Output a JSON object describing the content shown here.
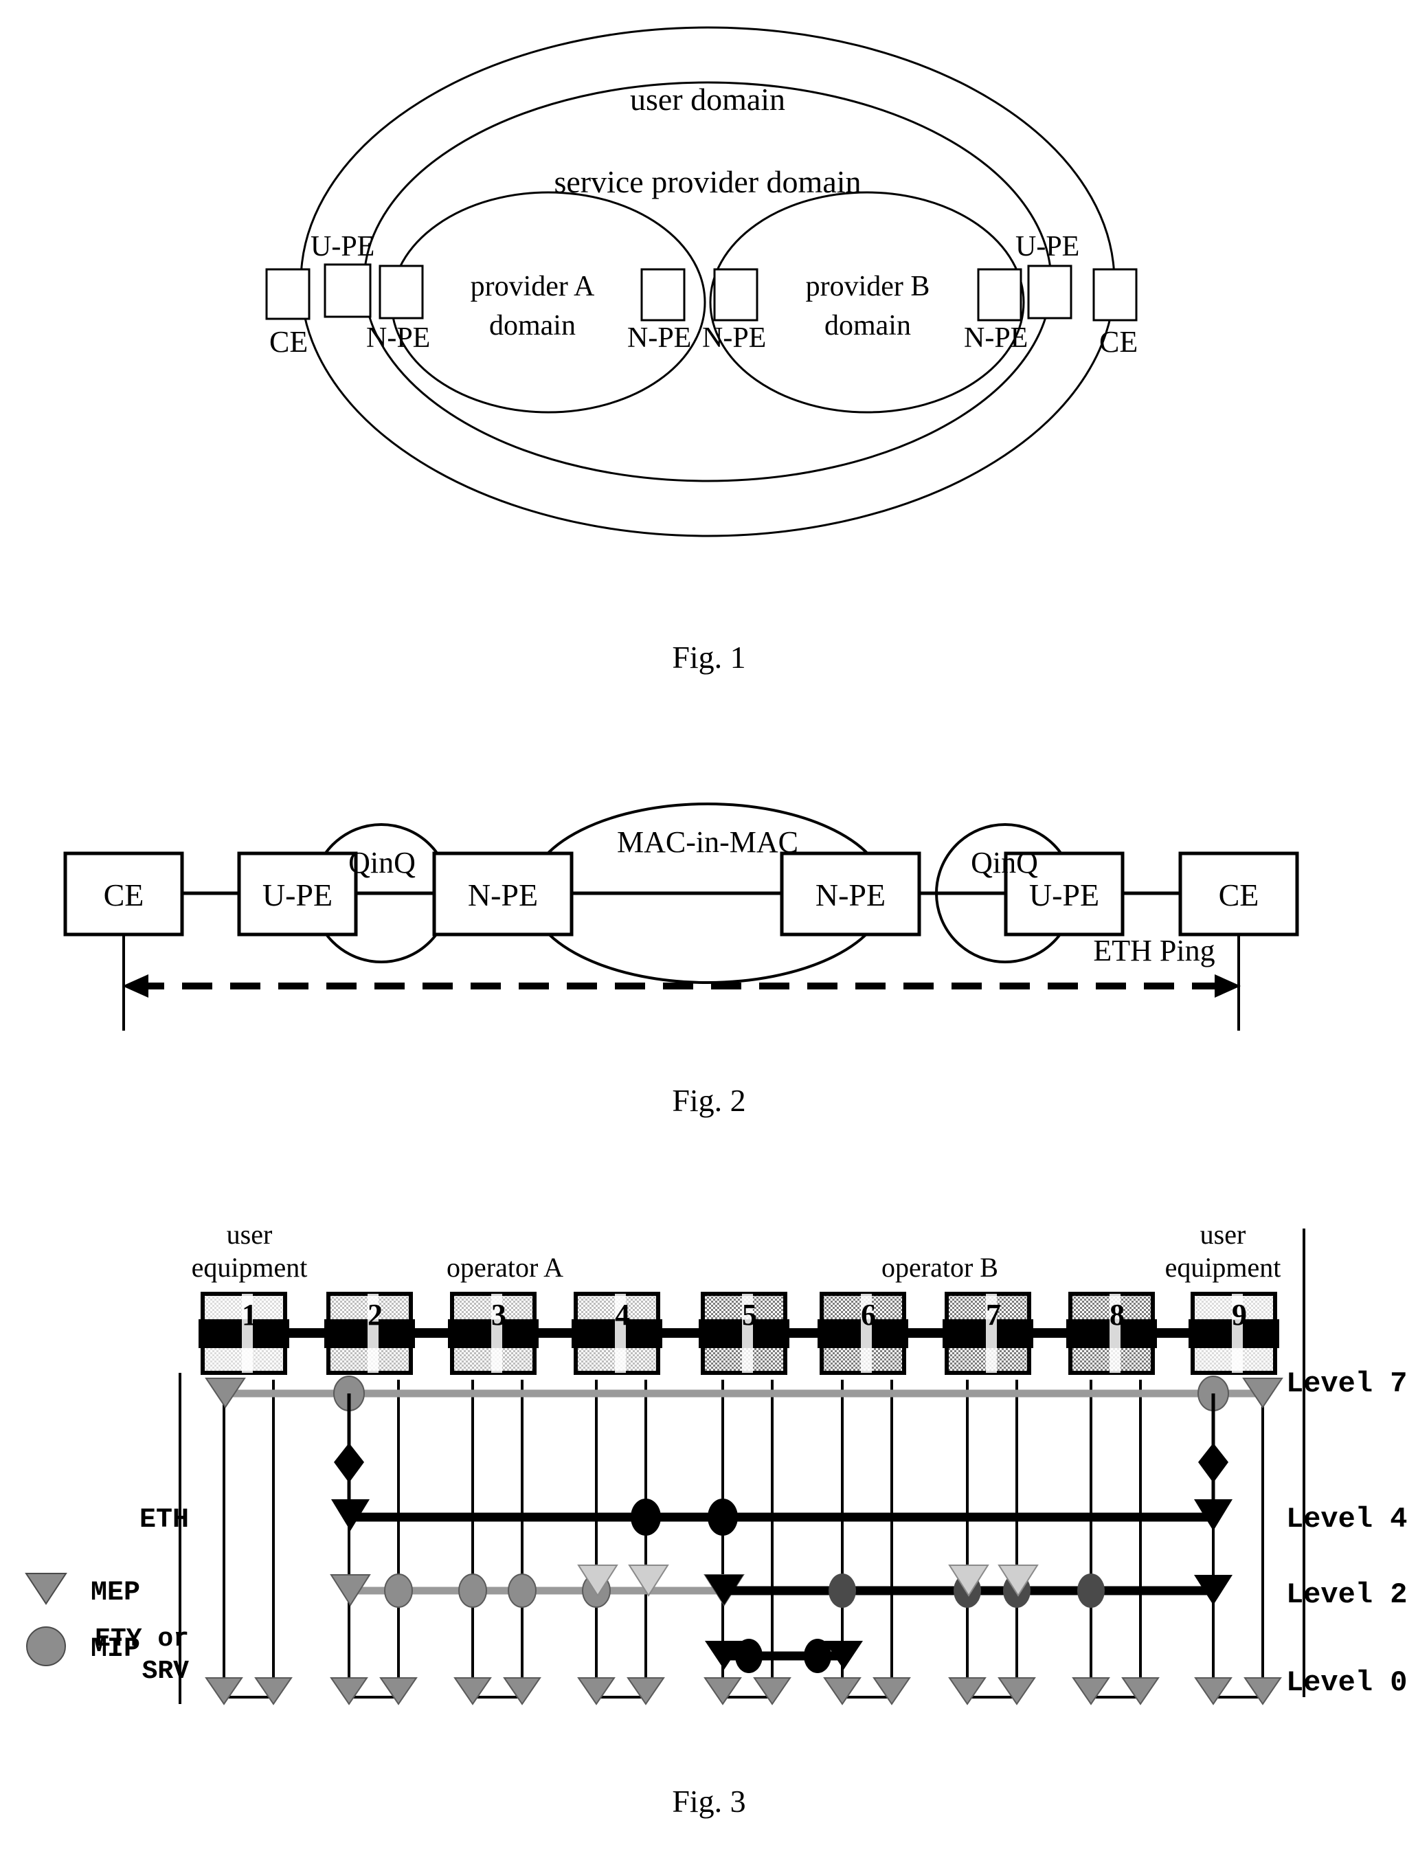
{
  "figure1": {
    "caption": "Fig. 1",
    "outer_domain_label": "user domain",
    "middle_domain_label": "service provider domain",
    "provider_a_label_line1": "provider A",
    "provider_a_label_line2": "domain",
    "provider_b_label_line1": "provider B",
    "provider_b_label_line2": "domain",
    "nodes": [
      {
        "id": "ce-left",
        "label": "CE",
        "label_pos": "below"
      },
      {
        "id": "upe-left",
        "label": "U-PE",
        "label_pos": "above"
      },
      {
        "id": "npe-a-left",
        "label": "N-PE",
        "label_pos": "below"
      },
      {
        "id": "npe-a-right",
        "label": "N-PE",
        "label_pos": "below"
      },
      {
        "id": "npe-b-left",
        "label": "N-PE",
        "label_pos": "below"
      },
      {
        "id": "npe-b-right",
        "label": "N-PE",
        "label_pos": "below"
      },
      {
        "id": "upe-right",
        "label": "U-PE",
        "label_pos": "above"
      },
      {
        "id": "ce-right",
        "label": "CE",
        "label_pos": "below"
      }
    ]
  },
  "figure2": {
    "caption": "Fig. 2",
    "boxes": [
      {
        "id": "ce-left",
        "label": "CE"
      },
      {
        "id": "upe-left",
        "label": "U-PE"
      },
      {
        "id": "npe-left",
        "label": "N-PE"
      },
      {
        "id": "npe-right",
        "label": "N-PE"
      },
      {
        "id": "upe-right",
        "label": "U-PE"
      },
      {
        "id": "ce-right",
        "label": "CE"
      }
    ],
    "cloud_left_label": "QinQ",
    "cloud_center_label": "MAC-in-MAC",
    "cloud_right_label": "QinQ",
    "arrow_label": "ETH Ping"
  },
  "figure3": {
    "caption": "Fig. 3",
    "top_labels": {
      "user_equipment_left_line1": "user",
      "user_equipment_left_line2": "equipment",
      "operator_a": "operator A",
      "operator_b": "operator B",
      "user_equipment_right_line1": "user",
      "user_equipment_right_line2": "equipment"
    },
    "nodes": [
      "1",
      "2",
      "3",
      "4",
      "5",
      "6",
      "7",
      "8",
      "9"
    ],
    "level_labels": [
      "Level 7",
      "Level 4",
      "Level 2",
      "Level 0"
    ],
    "side_labels": {
      "eth": "ETH",
      "ety_or_srv_line1": "ETY or",
      "ety_or_srv_line2": "SRV"
    },
    "legend": [
      {
        "symbol": "triangle-down",
        "label": "MEP"
      },
      {
        "symbol": "circle",
        "label": "MIP"
      }
    ]
  }
}
